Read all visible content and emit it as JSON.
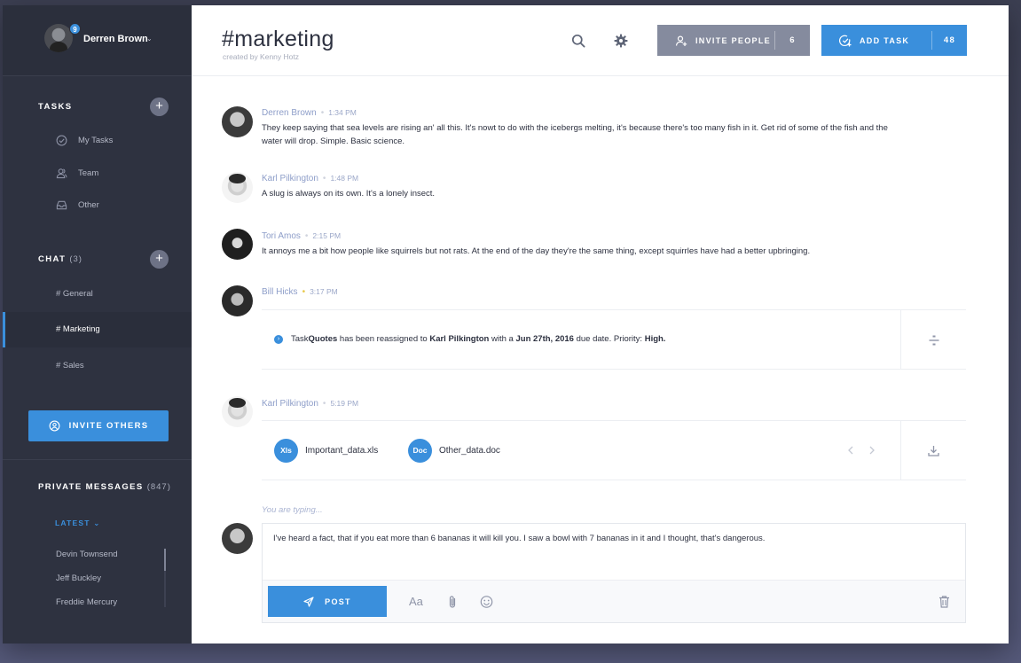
{
  "user": {
    "name": "Derren Brown",
    "badge": "9"
  },
  "sidebar": {
    "tasks_title": "TASKS",
    "task_items": [
      "My Tasks",
      "Team",
      "Other"
    ],
    "chat_title": "CHAT",
    "chat_count": "(3)",
    "chat_items": [
      "# General",
      "# Marketing",
      "# Sales"
    ],
    "invite_label": "INVITE OTHERS",
    "pm_title": "PRIVATE MESSAGES",
    "pm_count": "(847)",
    "latest_label": "LATEST",
    "pm_items": [
      "Devin Townsend",
      "Jeff Buckley",
      "Freddie Mercury"
    ]
  },
  "header": {
    "channel": "#marketing",
    "subtitle": "created by Kenny Hotz",
    "invite_label": "INVITE PEOPLE",
    "invite_count": "6",
    "add_label": "ADD TASK",
    "add_count": "48"
  },
  "messages": [
    {
      "name": "Derren Brown",
      "time": "1:34 PM",
      "text": "They keep saying that sea levels are rising an' all this. It's nowt to do with the icebergs melting, it's because there's too many fish in it. Get rid of some of the fish and the water will drop. Simple. Basic science."
    },
    {
      "name": "Karl Pilkington",
      "time": "1:48 PM",
      "text": "A slug is always on its own. It's a lonely insect."
    },
    {
      "name": "Tori Amos",
      "time": "2:15 PM",
      "text": "It annoys me a bit how people like squirrels but not rats. At the end of the day they're the same thing, except squirrles have had a better upbringing."
    },
    {
      "name": "Bill Hicks",
      "time": "3:17 PM"
    },
    {
      "name": "Karl Pilkington",
      "time": "5:19 PM"
    }
  ],
  "task_notice": {
    "p1": "Task ",
    "task": "Quotes",
    "p2": " has been reassigned to ",
    "assignee": "Karl Pilkington",
    "p3": " with a ",
    "date": "Jun 27th, 2016",
    "p4": " due date. Priority: ",
    "priority": "High."
  },
  "files": [
    {
      "type": "Xls",
      "name": "Important_data.xls"
    },
    {
      "type": "Doc",
      "name": "Other_data.doc"
    }
  ],
  "composer": {
    "typing": "You are typing...",
    "text": "I've heard a fact, that if you eat more than 6 bananas it will kill you. I saw a bowl with 7 bananas in it and I thought, that's dangerous.",
    "post_label": "POST",
    "font_label": "Aa"
  },
  "colors": {
    "accent": "#3a8fdc",
    "sidebar": "#2e3240",
    "secondary_button": "#858b9e"
  }
}
